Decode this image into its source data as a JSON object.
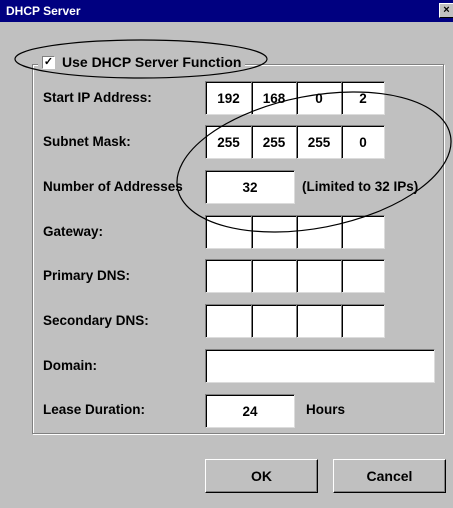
{
  "window": {
    "title": "DHCP Server",
    "close_glyph": "×"
  },
  "use_dhcp": {
    "label": "Use DHCP Server Function",
    "checked": true,
    "check_glyph": "✓"
  },
  "rows": {
    "start_ip": {
      "label": "Start IP Address:",
      "octets": [
        "192",
        "168",
        "0",
        "2"
      ]
    },
    "subnet_mask": {
      "label": "Subnet Mask:",
      "octets": [
        "255",
        "255",
        "255",
        "0"
      ]
    },
    "num_addresses": {
      "label": "Number of Addresses",
      "value": "32",
      "note": "(Limited to 32 IPs)"
    },
    "gateway": {
      "label": "Gateway:",
      "octets": [
        "",
        "",
        "",
        ""
      ]
    },
    "primary_dns": {
      "label": "Primary DNS:",
      "octets": [
        "",
        "",
        "",
        ""
      ]
    },
    "secondary_dns": {
      "label": "Secondary DNS:",
      "octets": [
        "",
        "",
        "",
        ""
      ]
    },
    "domain": {
      "label": "Domain:",
      "value": ""
    },
    "lease": {
      "label": "Lease Duration:",
      "value": "24",
      "unit": "Hours"
    }
  },
  "buttons": {
    "ok": "OK",
    "cancel": "Cancel"
  },
  "colors": {
    "titlebar": "#000080",
    "face": "#c0c0c0",
    "annotation": "#000000"
  }
}
